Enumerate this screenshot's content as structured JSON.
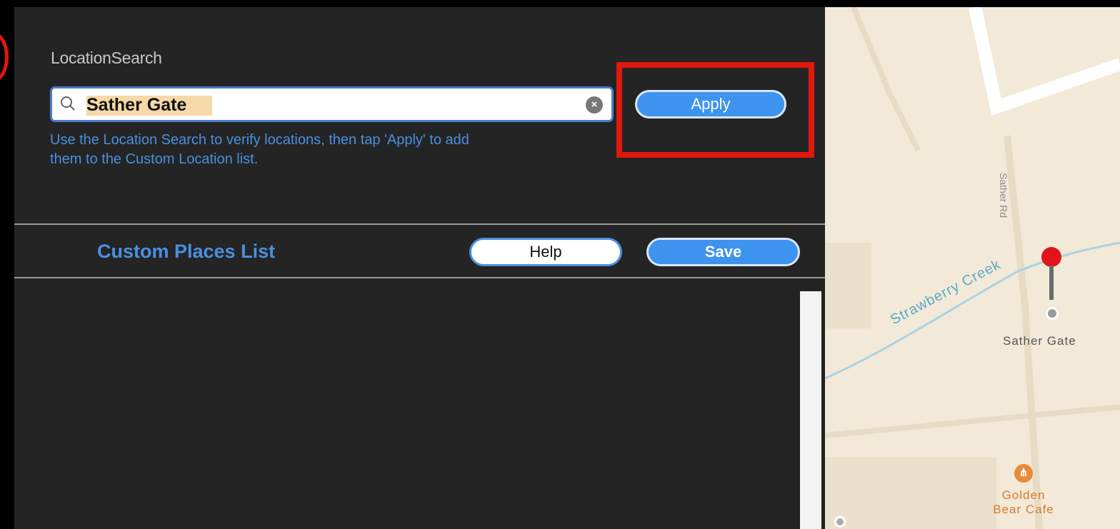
{
  "location_search": {
    "section_label": "LocationSearch",
    "search_value": "Sather Gate",
    "hint_line1": "Use the Location Search to verify locations, then tap 'Apply' to add",
    "hint_line2": "them to the Custom Location list.",
    "apply_label": "Apply"
  },
  "custom_places": {
    "title": "Custom Places List",
    "help_label": "Help",
    "save_label": "Save"
  },
  "map": {
    "street_label": "Sather Rd",
    "creek_label": "Strawberry Creek",
    "landmark_label": "Sather Gate",
    "cafe_label_line1": "Golden",
    "cafe_label_line2": "Bear Cafe",
    "cafe_icon": "fork-knife-icon",
    "pin_icon": "map-pin-icon"
  },
  "colors": {
    "accent": "#3d93ee",
    "highlight_box": "#e0180d",
    "panel_bg": "#242424"
  }
}
